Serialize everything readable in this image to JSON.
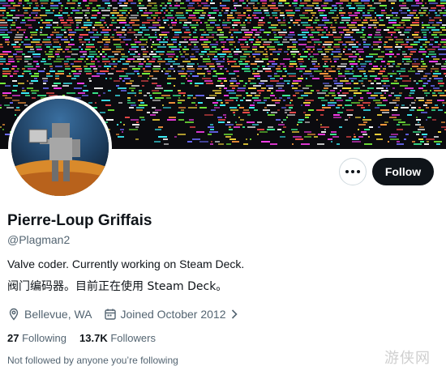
{
  "profile": {
    "name": "Pierre-Loup Griffais",
    "handle": "@Plagman2",
    "bio_line1": "Valve coder. Currently working on Steam Deck.",
    "bio_line2": "阀门编码器。目前正在使用 Steam Deck。",
    "location": "Bellevue, WA",
    "joined": "Joined October 2012",
    "following_count": "27",
    "following_label": "Following",
    "followers_count": "13.7K",
    "followers_label": "Followers",
    "followed_by_note": "Not followed by anyone you’re following"
  },
  "actions": {
    "follow_label": "Follow",
    "more_icon": "more-dots-icon"
  },
  "icons": {
    "location": "location-pin-icon",
    "calendar": "calendar-icon",
    "chevron": "chevron-right-icon"
  },
  "colors": {
    "primary_text": "#0f1419",
    "secondary_text": "#536471",
    "follow_bg": "#0f1419",
    "banner_bg": "#0b0b0f"
  },
  "watermark": "游侠网"
}
